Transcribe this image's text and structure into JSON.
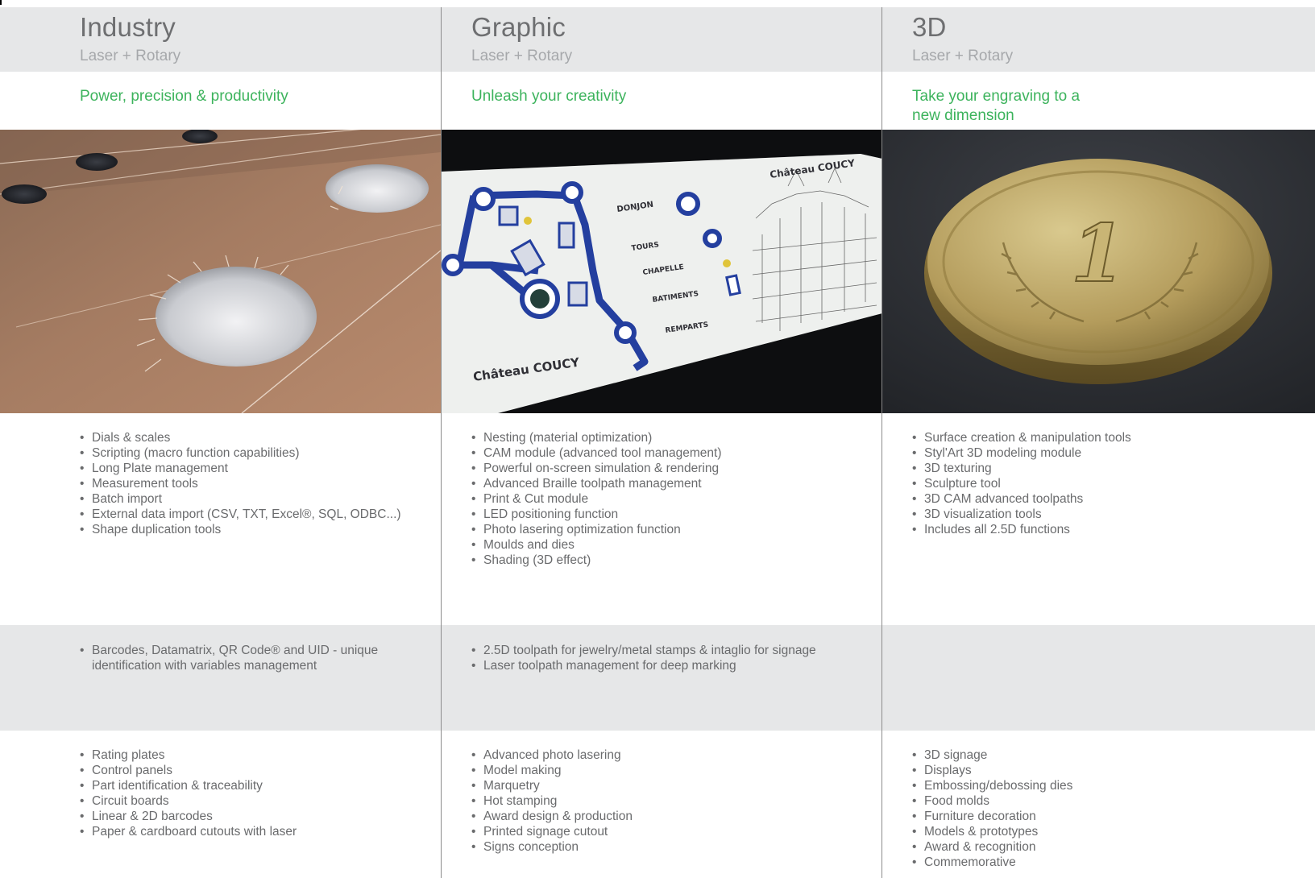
{
  "columns": [
    {
      "title": "Industry",
      "subtitle": "Laser + Rotary",
      "tagline": "Power, precision & productivity",
      "image": "engraved-dial-panel-photo",
      "features": [
        "Dials & scales",
        "Scripting (macro function capabilities)",
        "Long Plate management",
        "Measurement tools",
        "Batch import",
        "External data import (CSV, TXT, Excel®, SQL, ODBC...)",
        "Shape duplication tools"
      ],
      "marking": [
        "Barcodes, Datamatrix, QR Code® and UID - unique identification with variables management"
      ],
      "applications": [
        "Rating plates",
        "Control panels",
        "Part identification & traceability",
        "Circuit boards",
        "Linear & 2D barcodes",
        "Paper & cardboard cutouts with laser"
      ]
    },
    {
      "title": "Graphic",
      "subtitle": "Laser + Rotary",
      "tagline": "Unleash your creativity",
      "image": "chateau-coucy-signage-plate-photo",
      "image_text": {
        "top_right": "Château COUCY",
        "bottom_left": "Château COUCY",
        "labels": [
          "DONJON",
          "TOURS",
          "CHAPELLE",
          "BATIMENTS",
          "REMPARTS"
        ]
      },
      "features": [
        "Nesting (material optimization)",
        "CAM module (advanced tool management)",
        "Powerful on-screen simulation & rendering",
        "Advanced Braille toolpath management",
        "Print & Cut module",
        "LED positioning function",
        "Photo lasering optimization function",
        "Moulds and dies",
        "Shading (3D effect)"
      ],
      "marking": [
        "2.5D toolpath for jewelry/metal stamps & intaglio for signage",
        "Laser toolpath management for deep marking"
      ],
      "applications": [
        "Advanced photo lasering",
        "Model making",
        "Marquetry",
        "Hot stamping",
        "Award design & production",
        "Printed signage cutout",
        "Signs conception"
      ]
    },
    {
      "title": "3D",
      "subtitle": "Laser + Rotary",
      "tagline": "Take your engraving to a new dimension",
      "image": "engraved-gold-coin-photo",
      "image_text": {
        "coin_numeral": "1"
      },
      "features": [
        "Surface creation & manipulation tools",
        "Styl'Art 3D modeling module",
        "3D texturing",
        "Sculpture tool",
        "3D CAM advanced toolpaths",
        "3D visualization tools",
        "Includes all 2.5D functions"
      ],
      "marking": [],
      "applications": [
        "3D signage",
        "Displays",
        "Embossing/debossing dies",
        "Food molds",
        "Furniture decoration",
        "Models & prototypes",
        "Award & recognition",
        "Commemorative"
      ]
    }
  ],
  "colors": {
    "header_band": "#e6e7e8",
    "title": "#6e6f71",
    "subtitle": "#a6a8ab",
    "tagline": "#3cb35c",
    "body_text": "#6a6b6d",
    "divider": "#8c8c8c"
  }
}
